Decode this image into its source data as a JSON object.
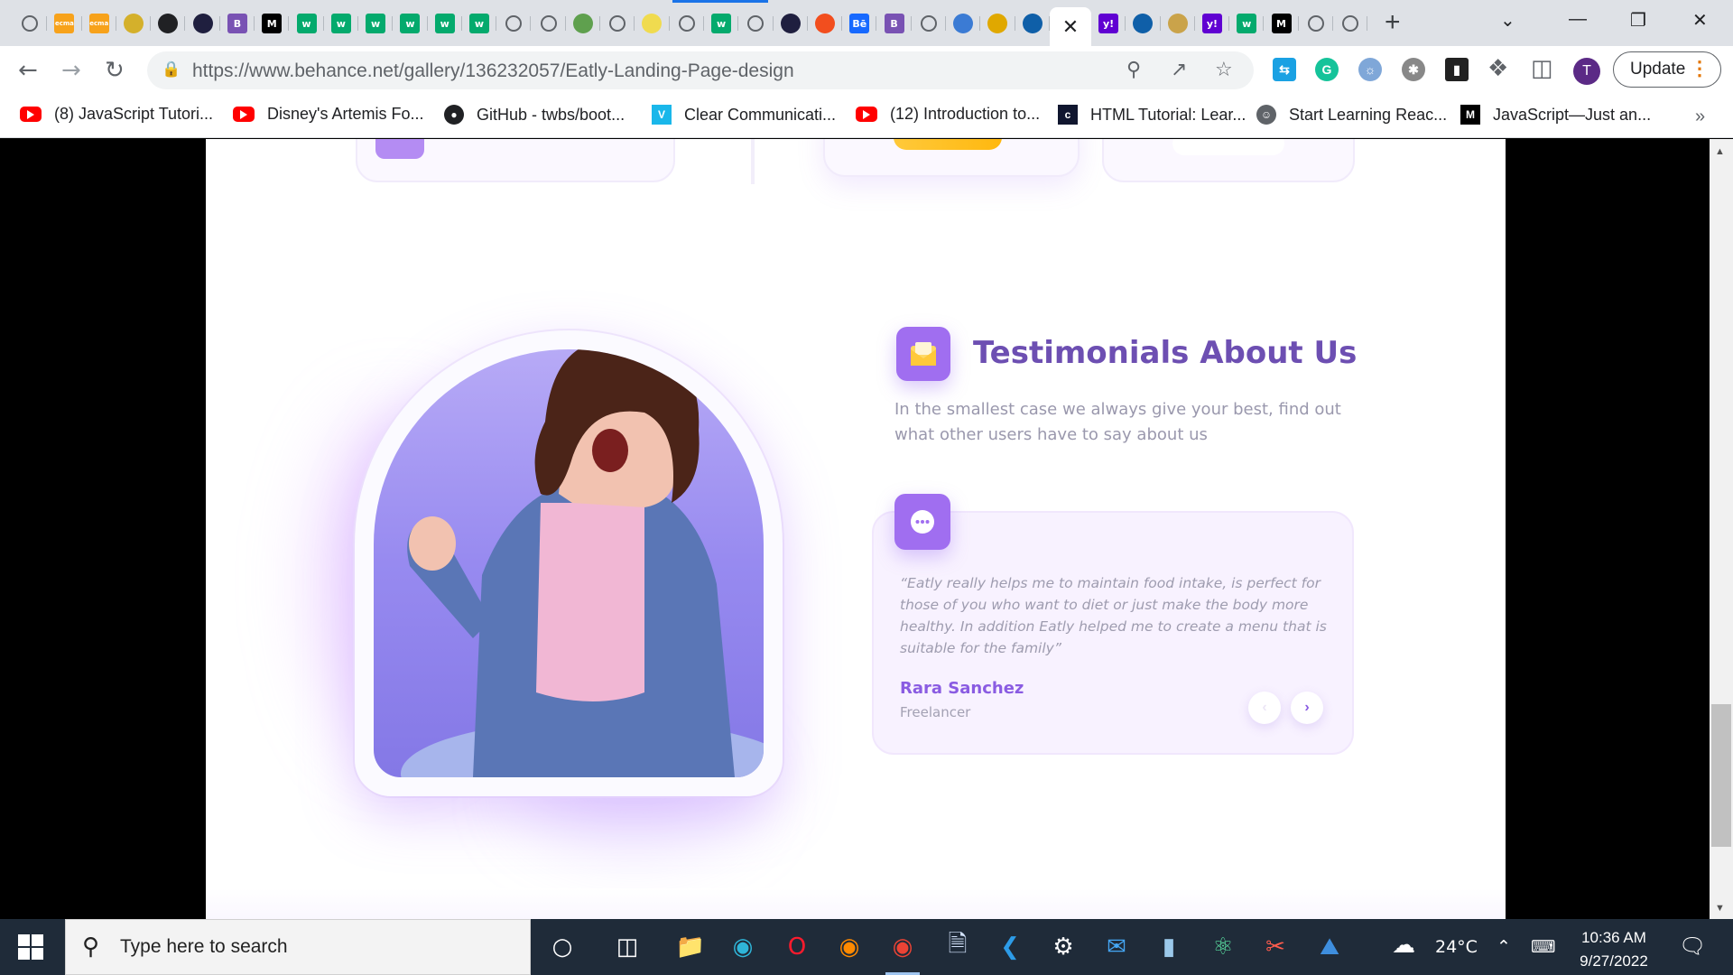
{
  "browser": {
    "tabs": [
      {
        "icon": "globe-icon",
        "color": "#5f6368"
      },
      {
        "icon": "ecma-icon",
        "color": "#f7a21b",
        "text": "ecma"
      },
      {
        "icon": "ecma-icon",
        "color": "#f7a21b",
        "text": "ecma"
      },
      {
        "icon": "lightning-icon",
        "color": "#d4b02b"
      },
      {
        "icon": "github-icon",
        "color": "#202124"
      },
      {
        "icon": "codecademy-icon",
        "color": "#1f1f3f"
      },
      {
        "icon": "bootstrap-icon",
        "color": "#7952b3",
        "text": "B"
      },
      {
        "icon": "medium-icon",
        "color": "#000000",
        "text": "M"
      },
      {
        "icon": "w3schools-icon",
        "color": "#04aa6d",
        "text": "w"
      },
      {
        "icon": "w3schools-icon",
        "color": "#04aa6d",
        "text": "w"
      },
      {
        "icon": "w3schools-icon",
        "color": "#04aa6d",
        "text": "w"
      },
      {
        "icon": "w3schools-icon",
        "color": "#04aa6d",
        "text": "w"
      },
      {
        "icon": "w3schools-icon",
        "color": "#04aa6d",
        "text": "w"
      },
      {
        "icon": "w3schools-icon",
        "color": "#04aa6d",
        "text": "w"
      },
      {
        "icon": "globe-icon",
        "color": "#5f6368"
      },
      {
        "icon": "globe-icon",
        "color": "#5f6368"
      },
      {
        "icon": "nodejs-icon",
        "color": "#5fa04e"
      },
      {
        "icon": "globe-icon",
        "color": "#5f6368"
      },
      {
        "icon": "js-icon",
        "color": "#f0db4f"
      },
      {
        "icon": "globe-icon",
        "color": "#5f6368"
      },
      {
        "icon": "w3schools-icon",
        "color": "#04aa6d",
        "text": "w"
      },
      {
        "icon": "globe-icon",
        "color": "#5f6368"
      },
      {
        "icon": "codecademy-icon",
        "color": "#1f1f3f"
      },
      {
        "icon": "figma-icon",
        "color": "#f24e1e"
      },
      {
        "icon": "behance-icon",
        "color": "#1769ff",
        "text": "Bē"
      },
      {
        "icon": "bootstrap-icon",
        "color": "#7952b3",
        "text": "B"
      },
      {
        "icon": "globe-icon",
        "color": "#5f6368"
      },
      {
        "icon": "swirl-icon",
        "color": "#3b7bd4"
      },
      {
        "icon": "mascot-icon",
        "color": "#e0a800"
      },
      {
        "icon": "circle-icon",
        "color": "#0f5fa8"
      },
      {
        "icon": "close-icon",
        "color": "#202124",
        "active": true
      },
      {
        "icon": "yahoo-icon",
        "color": "#6001d2",
        "text": "y!"
      },
      {
        "icon": "circle-icon",
        "color": "#0f5fa8"
      },
      {
        "icon": "react-icon",
        "color": "#caa34a"
      },
      {
        "icon": "yahoo-icon",
        "color": "#6001d2",
        "text": "y!"
      },
      {
        "icon": "w3schools-icon",
        "color": "#04aa6d",
        "text": "w"
      },
      {
        "icon": "medium-icon",
        "color": "#000000",
        "text": "M"
      },
      {
        "icon": "globe-icon",
        "color": "#5f6368"
      },
      {
        "icon": "globe-icon",
        "color": "#5f6368"
      }
    ],
    "url_host": "https://www.behance.net",
    "url_path": "/gallery/136232057/Eatly-Landing-Page-design",
    "profile_initial": "T",
    "update_label": "Update",
    "bookmarks": [
      {
        "label": "(8) JavaScript Tutori...",
        "icon": "youtube-icon"
      },
      {
        "label": "Disney's Artemis Fo...",
        "icon": "youtube-icon"
      },
      {
        "label": "GitHub - twbs/boot...",
        "icon": "github-icon"
      },
      {
        "label": "Clear Communicati...",
        "icon": "vimeo-icon"
      },
      {
        "label": "(12) Introduction to...",
        "icon": "youtube-icon"
      },
      {
        "label": "HTML Tutorial: Lear...",
        "icon": "codecademy-icon"
      },
      {
        "label": "Start Learning Reac...",
        "icon": "scrimba-icon"
      },
      {
        "label": "JavaScript—Just an...",
        "icon": "medium-icon"
      }
    ]
  },
  "page": {
    "testimonials": {
      "title": "Testimonials About Us",
      "subtitle": "In the smallest case we always give your best, find out what other users have to say about us",
      "quote": "“Eatly really helps me to maintain food intake, is perfect for those of you who want to diet or just make the body more healthy. In addition Eatly helped me to create a menu that is suitable for the family”",
      "author": "Rara Sanchez",
      "role": "Freelancer",
      "accent_color": "#a06ef0",
      "title_color": "#6d4fb2"
    }
  },
  "taskbar": {
    "search_placeholder": "Type here to search",
    "temperature": "24°C",
    "time": "10:36 AM",
    "date": "9/27/2022"
  }
}
